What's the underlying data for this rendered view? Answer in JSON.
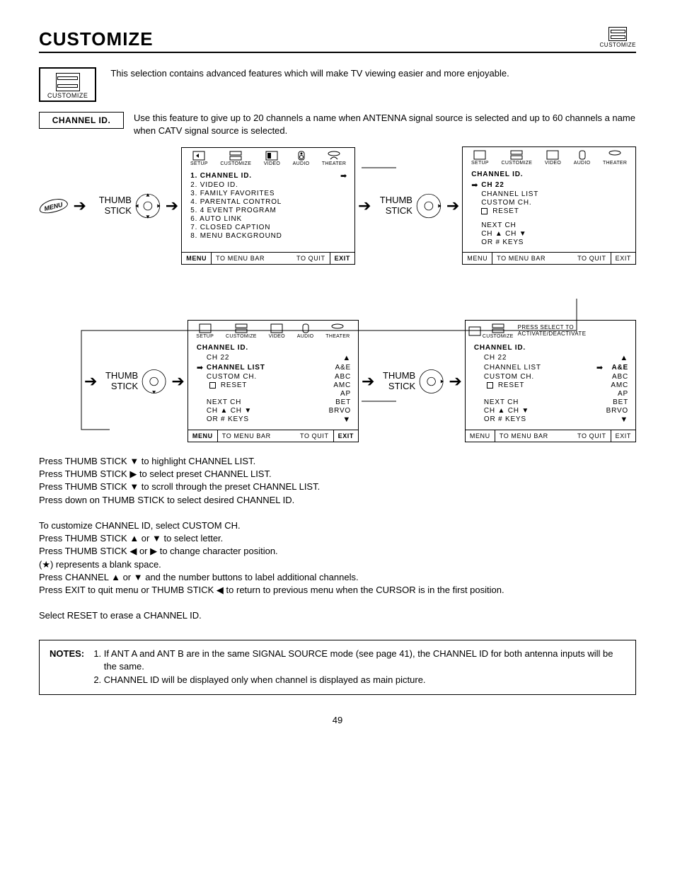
{
  "page": {
    "title": "Customize",
    "page_number": "49",
    "corner_label": "CUSTOMIZE"
  },
  "intro": {
    "icon_label": "CUSTOMIZE",
    "text": "This selection contains advanced features which will make TV viewing easier and more enjoyable."
  },
  "feature": {
    "label": "CHANNEL ID.",
    "text": "Use this feature to give up to 20 channels a name when ANTENNA signal source is selected and up to 60 channels a name when CATV signal source is selected."
  },
  "tabs": [
    "SETUP",
    "CUSTOMIZE",
    "VIDEO",
    "AUDIO",
    "THEATER"
  ],
  "thumb_label_l1": "THUMB",
  "thumb_label_l2": "STICK",
  "menu_btn": "MENU",
  "panel1": {
    "items": [
      "1. CHANNEL ID.",
      "2. VIDEO ID.",
      "3. FAMILY FAVORITES",
      "4. PARENTAL CONTROL",
      "5. 4 EVENT PROGRAM",
      "6. AUTO LINK",
      "7. CLOSED CAPTION",
      "8. MENU BACKGROUND"
    ]
  },
  "panel2": {
    "heading": "CHANNEL ID.",
    "ch": "CH 22",
    "l1": "CHANNEL LIST",
    "l2": "CUSTOM CH.",
    "l3": "RESET",
    "n1": "NEXT CH",
    "n2": "CH ▲ CH ▼",
    "n3": "OR # KEYS"
  },
  "panel3": {
    "heading": "CHANNEL ID.",
    "ch": "CH 22",
    "l1": "CHANNEL LIST",
    "l1r": "A&E",
    "l2": "CUSTOM CH.",
    "l2r": "ABC",
    "l3": "RESET",
    "l3r": "AMC",
    "r4": "AP",
    "n1": "NEXT CH",
    "n1r": "BET",
    "n2": "CH ▲ CH ▼",
    "n2r": "BRVO",
    "n3": "OR # KEYS"
  },
  "panel4": {
    "topmsg": "PRESS SELECT TO ACTIVATE/DEACTIVATE",
    "heading": "CHANNEL ID.",
    "ch": "CH 22",
    "l1": "CHANNEL LIST",
    "l1r": "A&E",
    "l2": "CUSTOM CH.",
    "l2r": "ABC",
    "l3": "RESET",
    "l3r": "AMC",
    "r4": "AP",
    "n1": "NEXT CH",
    "n1r": "BET",
    "n2": "CH ▲ CH ▼",
    "n2r": "BRVO",
    "n3": "OR # KEYS"
  },
  "footer": {
    "a": "MENU",
    "b": "TO MENU BAR",
    "c": "TO QUIT",
    "d": "EXIT"
  },
  "instructions": {
    "p1": "Press THUMB STICK ▼ to highlight CHANNEL LIST.",
    "p2": "Press THUMB STICK ▶ to select preset CHANNEL LIST.",
    "p3": "Press THUMB STICK ▼ to scroll through the preset CHANNEL LIST.",
    "p4": "Press down on THUMB STICK to select desired CHANNEL ID.",
    "p5": "To customize CHANNEL ID, select CUSTOM CH.",
    "p6": "Press THUMB STICK ▲ or ▼ to select letter.",
    "p7": "Press THUMB STICK ◀ or ▶ to change character position.",
    "p8": "(★) represents a blank space.",
    "p9": "Press CHANNEL ▲ or ▼ and the number buttons to label additional channels.",
    "p10": "Press EXIT to quit menu or THUMB STICK ◀ to return to previous menu when the CURSOR is in the first position.",
    "p11": "Select RESET to erase a CHANNEL ID."
  },
  "notes": {
    "label": "NOTES:",
    "n1": "If ANT A and ANT B are in the same SIGNAL SOURCE mode (see page 41), the CHANNEL ID for both antenna inputs will be the same.",
    "n2": "CHANNEL ID will be displayed only when channel is displayed as main picture."
  },
  "glyphs": {
    "up": "▲",
    "down": "▼",
    "right_solid": "➡",
    "right_tri": "▶"
  }
}
